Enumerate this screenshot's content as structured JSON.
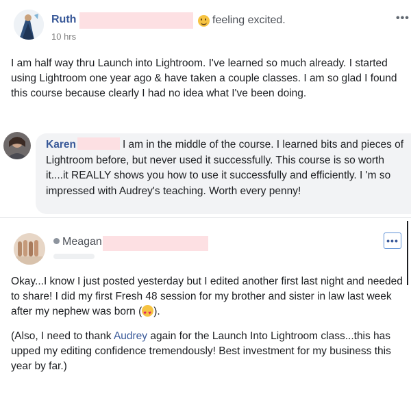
{
  "post1": {
    "author": "Ruth",
    "feeling": "feeling excited.",
    "time": "10 hrs",
    "more": "•••",
    "body": "I am half way thru Launch into Lightroom. I've learned so much already. I started using Lightroom one year ago & have taken a couple classes. I am so glad I found this course because clearly I had no idea what I've been doing."
  },
  "comment": {
    "author": "Karen",
    "text": "I am in the middle of the course. I learned bits and pieces of Lightroom before, but never used it successfully. This course is so worth it....it REALLY shows you how to use it successfully and efficiently. I 'm so impressed with Audrey's teaching. Worth every penny!"
  },
  "post3": {
    "author": "Meagan",
    "more": "•••",
    "para1": "Okay...I know I just posted yesterday but I edited another first last night and needed to share! I did my first Fresh 48 session for my brother and sister in law last week after my nephew was born (",
    "para1_end": ").",
    "para2_start": "(Also, I need to thank ",
    "para2_link": "Audrey",
    "para2_end": " again for the Launch Into Lightroom class...this has upped my editing confidence tremendously! Best investment for my business this year by far.)"
  },
  "colors": {
    "link": "#385898",
    "bubble": "#f2f3f5",
    "redaction": "#fde0e3"
  }
}
